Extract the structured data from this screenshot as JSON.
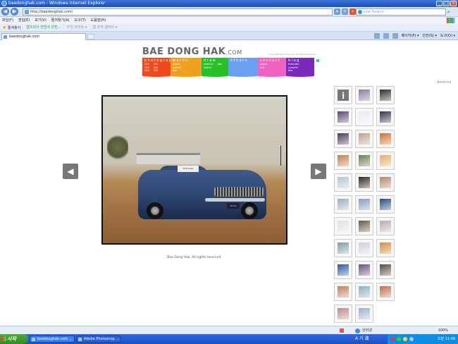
{
  "window": {
    "title": "baedonghak.com - Windows Internet Explorer",
    "address": "http://baedonghak.com/",
    "search_placeholder": "Live Search"
  },
  "menu": [
    "파일(F)",
    "편집(E)",
    "보기(V)",
    "즐겨찾기(A)",
    "도구(T)",
    "도움말(H)"
  ],
  "favorites": {
    "label": "즐겨찾기",
    "item1": "웹조회사 연방과 만한...",
    "item2": "추천 사이트 ▾",
    "item3": "웹 조각 갤러리 ▾"
  },
  "tab": {
    "title": "baedonghak.com"
  },
  "commands": [
    "페이지(P) ▾",
    "안전(S) ▾",
    "도구(O) ▾"
  ],
  "site": {
    "logo_main": "BAE DONG HAK",
    "logo_suffix": ".COM",
    "copyright": "Copyright Bae Dong Hak All Rights Reserved",
    "region": "America",
    "nav": [
      {
        "head": "photography",
        "color": "#f04a1c",
        "cols": [
          [
            "001",
            "002",
            "003"
          ],
          [
            "004",
            "005",
            "006"
          ]
        ]
      },
      {
        "head": "words",
        "color": "#f0a020",
        "cols": [
          [
            "others",
            "written",
            "bbs"
          ]
        ]
      },
      {
        "head": "draw",
        "color": "#28c028",
        "cols": [
          [
            "sketche",
            "digital"
          ],
          [
            "bbs"
          ]
        ]
      },
      {
        "head": "others",
        "color": "#6aa0f0",
        "cols": [
          []
        ]
      },
      {
        "head": "contact",
        "color": "#f062c0",
        "cols": [
          [
            "about",
            "bbs"
          ]
        ]
      },
      {
        "head": "blog",
        "color": "#7a2ab8",
        "cols": [
          [
            "textcube",
            "cyworld",
            "bbs"
          ]
        ]
      }
    ],
    "caption": "Bae Dong Hak. All rights reserved.",
    "photo_sign": "FOR SALE",
    "photo_plate": "KENIA",
    "prev_glyph": "◀",
    "next_glyph": "▶",
    "info_glyph": "i",
    "thumbnails": [
      "#8a7aa0",
      "#2c2c30",
      "#5a4870",
      "#e8e8f0",
      "#3a3050",
      "#4a3a5a",
      "#c0a090",
      "#d07030",
      "#c08050",
      "#6a8050",
      "#e0b070",
      "#b0c8d0",
      "#302820",
      "#b08870",
      "#a0b0c0",
      "#80a0c0",
      "#2a4a7a",
      "#e0e0e0",
      "#6a5a40",
      "#c0a8b0",
      "#80a0a0",
      "#d0d0e0",
      "#d09040",
      "#2a5aa0",
      "#6a5080",
      "#5a4a40",
      "#c08060",
      "#8ab0c0",
      "#c07050",
      "#c08890",
      "#a0b0d0"
    ]
  },
  "status": {
    "zone": "인터넷",
    "zoom": "100%"
  },
  "taskbar": {
    "start": "시작",
    "task1": "baedonghak.com ...",
    "task2": "Adobe Photoshop ...",
    "ime": "A 가 漢",
    "clock": "오전 11:48"
  }
}
